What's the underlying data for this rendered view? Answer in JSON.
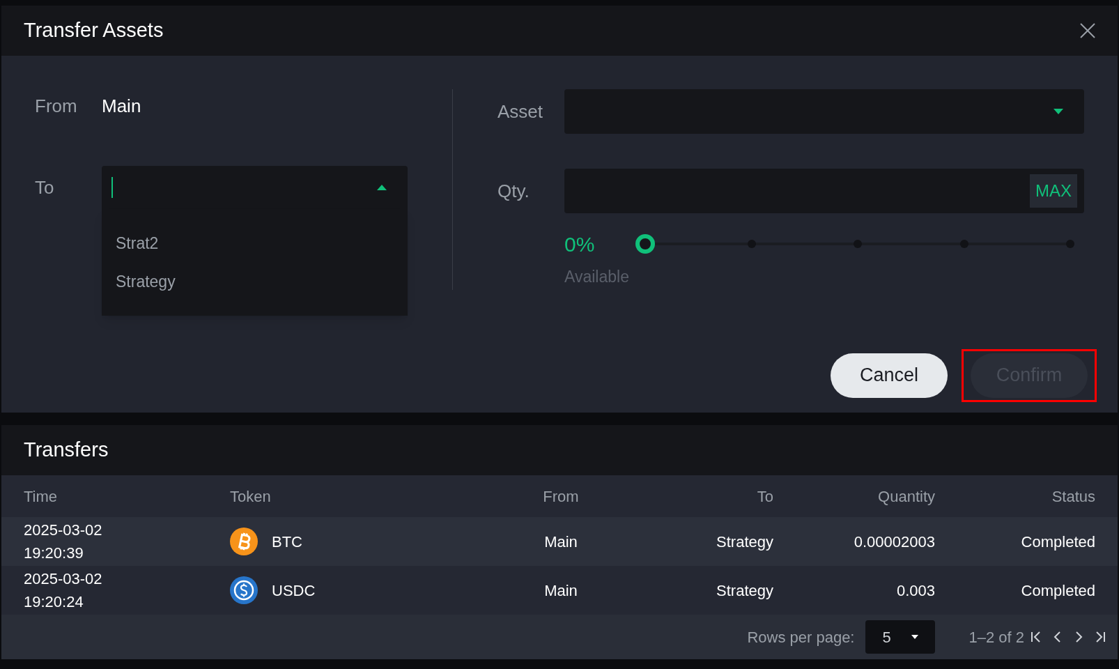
{
  "dialog": {
    "title": "Transfer Assets",
    "from": {
      "label": "From",
      "value": "Main"
    },
    "to": {
      "label": "To",
      "expanded": true,
      "options": [
        "Strat2",
        "Strategy"
      ]
    },
    "asset": {
      "label": "Asset",
      "expanded": false
    },
    "qty": {
      "label": "Qty.",
      "max_label": "MAX"
    },
    "slider": {
      "reading": "0%",
      "level": 0
    },
    "available_label": "Available",
    "buttons": [
      {
        "label": "Cancel",
        "kind": "secondary",
        "disabled": false,
        "highlighted": false
      },
      {
        "label": "Confirm",
        "kind": "primary",
        "disabled": true,
        "highlighted": true
      }
    ]
  },
  "transfers": {
    "title": "Transfers",
    "columns": [
      "Time",
      "Token",
      "From",
      "To",
      "Quantity",
      "Status"
    ],
    "rows": [
      {
        "time": [
          "2025-03-02",
          "19:20:39"
        ],
        "token": "BTC",
        "kind": "btc",
        "from": "Main",
        "to": "Strategy",
        "quantity": "0.00002003",
        "status": "Completed"
      },
      {
        "time": [
          "2025-03-02",
          "19:20:24"
        ],
        "token": "USDC",
        "kind": "usdc",
        "from": "Main",
        "to": "Strategy",
        "quantity": "0.003",
        "status": "Completed"
      }
    ],
    "pagination": {
      "rows_label": "Rows per page:",
      "rows_value": "5",
      "range": "1–2 of 2"
    }
  }
}
